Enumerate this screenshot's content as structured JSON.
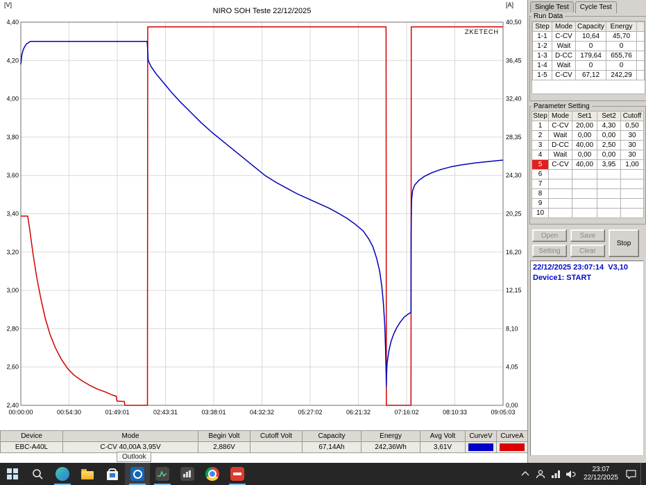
{
  "chart_data": {
    "type": "line",
    "title": "NIRO SOH Teste 22/12/2025",
    "watermark": "ZKETECH",
    "plot_bg": "#ffffff",
    "x_tick_labels": [
      "00:00:00",
      "00:54:30",
      "01:49:01",
      "02:43:31",
      "03:38:01",
      "04:32:32",
      "05:27:02",
      "06:21:32",
      "07:16:02",
      "08:10:33",
      "09:05:03"
    ],
    "x_range_hours": [
      0,
      9.084
    ],
    "y_left": {
      "unit": "[V]",
      "min": 2.4,
      "max": 4.4,
      "tick_labels": [
        "4,40",
        "4,20",
        "4,00",
        "3,80",
        "3,60",
        "3,40",
        "3,20",
        "3,00",
        "2,80",
        "2,60",
        "2,40"
      ]
    },
    "y_right": {
      "unit": "[A]",
      "min": 0.0,
      "max": 40.5,
      "tick_labels": [
        "40,50",
        "36,45",
        "32,40",
        "28,35",
        "24,30",
        "20,25",
        "16,20",
        "12,15",
        "8,10",
        "4,05",
        "0,00"
      ]
    },
    "grid": true,
    "legend_position": "none",
    "series": [
      {
        "name": "Current",
        "axis": "right",
        "color": "#d40000",
        "points": [
          [
            0,
            20
          ],
          [
            0.13,
            20
          ],
          [
            0.17,
            18.5
          ],
          [
            0.23,
            16
          ],
          [
            0.3,
            13.5
          ],
          [
            0.38,
            11.2
          ],
          [
            0.46,
            9.2
          ],
          [
            0.55,
            7.5
          ],
          [
            0.65,
            6.1
          ],
          [
            0.76,
            4.9
          ],
          [
            0.88,
            3.9
          ],
          [
            1,
            3.2
          ],
          [
            1.15,
            2.6
          ],
          [
            1.3,
            2.1
          ],
          [
            1.45,
            1.7
          ],
          [
            1.6,
            1.4
          ],
          [
            1.72,
            1.1
          ],
          [
            1.8,
            0.95
          ],
          [
            1.81,
            0.45
          ],
          [
            1.95,
            0.4
          ],
          [
            1.96,
            0
          ],
          [
            2.385,
            0
          ],
          [
            2.39,
            40
          ],
          [
            6.88,
            40
          ],
          [
            6.885,
            0
          ],
          [
            7.35,
            0
          ],
          [
            7.355,
            40
          ],
          [
            9.084,
            40
          ]
        ]
      },
      {
        "name": "Voltage",
        "axis": "left",
        "color": "#0000b8",
        "points": [
          [
            0,
            4.18
          ],
          [
            0.02,
            4.23
          ],
          [
            0.05,
            4.26
          ],
          [
            0.1,
            4.285
          ],
          [
            0.18,
            4.3
          ],
          [
            2.38,
            4.3
          ],
          [
            2.4,
            4.2
          ],
          [
            2.45,
            4.17
          ],
          [
            2.55,
            4.13
          ],
          [
            2.7,
            4.08
          ],
          [
            2.85,
            4.03
          ],
          [
            3,
            3.985
          ],
          [
            3.2,
            3.93
          ],
          [
            3.4,
            3.875
          ],
          [
            3.6,
            3.825
          ],
          [
            3.8,
            3.78
          ],
          [
            4,
            3.735
          ],
          [
            4.2,
            3.69
          ],
          [
            4.4,
            3.645
          ],
          [
            4.6,
            3.6
          ],
          [
            4.8,
            3.565
          ],
          [
            5,
            3.535
          ],
          [
            5.2,
            3.505
          ],
          [
            5.4,
            3.48
          ],
          [
            5.6,
            3.455
          ],
          [
            5.8,
            3.43
          ],
          [
            6,
            3.4
          ],
          [
            6.15,
            3.375
          ],
          [
            6.3,
            3.345
          ],
          [
            6.45,
            3.31
          ],
          [
            6.55,
            3.27
          ],
          [
            6.63,
            3.23
          ],
          [
            6.7,
            3.17
          ],
          [
            6.76,
            3.1
          ],
          [
            6.8,
            3.02
          ],
          [
            6.83,
            2.93
          ],
          [
            6.855,
            2.82
          ],
          [
            6.87,
            2.7
          ],
          [
            6.88,
            2.58
          ],
          [
            6.885,
            2.5
          ],
          [
            6.89,
            2.56
          ],
          [
            6.9,
            2.62
          ],
          [
            6.93,
            2.68
          ],
          [
            6.97,
            2.73
          ],
          [
            7.02,
            2.77
          ],
          [
            7.08,
            2.805
          ],
          [
            7.15,
            2.835
          ],
          [
            7.22,
            2.86
          ],
          [
            7.29,
            2.875
          ],
          [
            7.35,
            2.885
          ],
          [
            7.352,
            3.3
          ],
          [
            7.36,
            3.47
          ],
          [
            7.38,
            3.52
          ],
          [
            7.42,
            3.55
          ],
          [
            7.5,
            3.575
          ],
          [
            7.6,
            3.595
          ],
          [
            7.75,
            3.615
          ],
          [
            7.9,
            3.63
          ],
          [
            8.1,
            3.645
          ],
          [
            8.3,
            3.655
          ],
          [
            8.55,
            3.665
          ],
          [
            8.8,
            3.672
          ],
          [
            9,
            3.678
          ],
          [
            9.084,
            3.68
          ]
        ]
      }
    ]
  },
  "panel": {
    "tabs": [
      "Single Test",
      "Cycle Test"
    ],
    "active_tab": "Cycle Test",
    "run_data": {
      "title": "Run Data",
      "headers": [
        "Step",
        "Mode",
        "Capacity",
        "Energy"
      ],
      "rows": [
        [
          "1-1",
          "C-CV",
          "10,64",
          "45,70"
        ],
        [
          "1-2",
          "Wait",
          "0",
          "0"
        ],
        [
          "1-3",
          "D-CC",
          "179,64",
          "655,76"
        ],
        [
          "1-4",
          "Wait",
          "0",
          "0"
        ],
        [
          "1-5",
          "C-CV",
          "67,12",
          "242,29"
        ]
      ]
    },
    "parameters": {
      "title": "Parameter Setting",
      "headers": [
        "Step",
        "Mode",
        "Set1",
        "Set2",
        "Cutoff"
      ],
      "highlighted_step": "5",
      "rows": [
        [
          "1",
          "C-CV",
          "20,00",
          "4,30",
          "0,50"
        ],
        [
          "2",
          "Wait",
          "0,00",
          "0,00",
          "30"
        ],
        [
          "3",
          "D-CC",
          "40,00",
          "2,50",
          "30"
        ],
        [
          "4",
          "Wait",
          "0,00",
          "0,00",
          "30"
        ],
        [
          "5",
          "C-CV",
          "40,00",
          "3,95",
          "1,00"
        ],
        [
          "6",
          "",
          "",
          "",
          ""
        ],
        [
          "7",
          "",
          "",
          "",
          ""
        ],
        [
          "8",
          "",
          "",
          "",
          ""
        ],
        [
          "9",
          "",
          "",
          "",
          ""
        ],
        [
          "10",
          "",
          "",
          "",
          ""
        ]
      ]
    },
    "buttons": {
      "open": "Open",
      "save": "Save",
      "setting": "Setting",
      "clear": "Clear",
      "stop": "Stop"
    },
    "log_lines": [
      "22/12/2025 23:07:14  V3,10",
      "Device1: START"
    ]
  },
  "summary": {
    "headers": [
      "Device",
      "Mode",
      "Begin Volt",
      "Cutoff Volt",
      "Capacity",
      "Energy",
      "Avg Volt",
      "CurveV",
      "CurveA"
    ],
    "values": {
      "device": "EBC-A40L",
      "mode": "C-CV 40,00A 3,95V",
      "begin_volt": "2,886V",
      "cutoff_volt": "",
      "capacity": "67,14Ah",
      "energy": "242,36Wh",
      "avg_volt": "3,61V"
    },
    "curve_v_color": "#0000cc",
    "curve_a_color": "#dd0000"
  },
  "taskbar": {
    "tooltip": "Outlook",
    "clock": {
      "time": "23:07",
      "date": "22/12/2025"
    },
    "icon_names": [
      "start",
      "search",
      "edge",
      "file-explorer",
      "store",
      "outlook",
      "app-dark-1",
      "app-dark-2",
      "chrome",
      "eb-tester",
      "hidden-icons-chevron",
      "tray-user",
      "network",
      "speaker",
      "notification"
    ]
  }
}
